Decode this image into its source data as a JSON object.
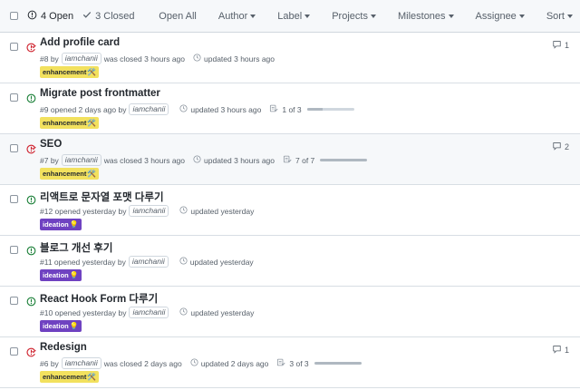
{
  "toolbar": {
    "open_label": "4 Open",
    "closed_label": "3 Closed",
    "filters": [
      "Open All",
      "Author",
      "Label",
      "Projects",
      "Milestones",
      "Assignee",
      "Sort"
    ]
  },
  "colors": {
    "open": "#1a7f37",
    "closed": "#cf222e",
    "enhancement": "#f2e15e",
    "ideation": "#6f42c1"
  },
  "labels": {
    "enhancement": "enhancement",
    "enhancement_emoji": "🛠️",
    "ideation": "ideation",
    "ideation_emoji": "💡"
  },
  "issues": [
    {
      "title": "Add profile card",
      "state": "closed",
      "number": "#8 by",
      "user": "iamchanii",
      "status": "was closed 3 hours ago",
      "updated": "updated 3 hours ago",
      "label": "enhancement",
      "comments": "1"
    },
    {
      "title": "Migrate post frontmatter",
      "state": "open",
      "number": "#9 opened 2 days ago by",
      "user": "iamchanii",
      "status": "",
      "updated": "updated 3 hours ago",
      "tasks": "1 of 3",
      "progress": 0.33,
      "label": "enhancement"
    },
    {
      "title": "SEO",
      "state": "closed",
      "number": "#7 by",
      "user": "iamchanii",
      "status": "was closed 3 hours ago",
      "updated": "updated 3 hours ago",
      "tasks": "7 of 7",
      "progress": 1.0,
      "label": "enhancement",
      "comments": "2"
    },
    {
      "title": "리액트로 문자열 포맷 다루기",
      "state": "open",
      "number": "#12 opened yesterday by",
      "user": "iamchanii",
      "status": "",
      "updated": "updated yesterday",
      "label": "ideation"
    },
    {
      "title": "블로그 개선 후기",
      "state": "open",
      "number": "#11 opened yesterday by",
      "user": "iamchanii",
      "status": "",
      "updated": "updated yesterday",
      "label": "ideation"
    },
    {
      "title": "React Hook Form 다루기",
      "state": "open",
      "number": "#10 opened yesterday by",
      "user": "iamchanii",
      "status": "",
      "updated": "updated yesterday",
      "label": "ideation"
    },
    {
      "title": "Redesign",
      "state": "closed",
      "number": "#6 by",
      "user": "iamchanii",
      "status": "was closed 2 days ago",
      "updated": "updated 2 days ago",
      "tasks": "3 of 3",
      "progress": 1.0,
      "label": "enhancement",
      "comments": "1"
    }
  ]
}
